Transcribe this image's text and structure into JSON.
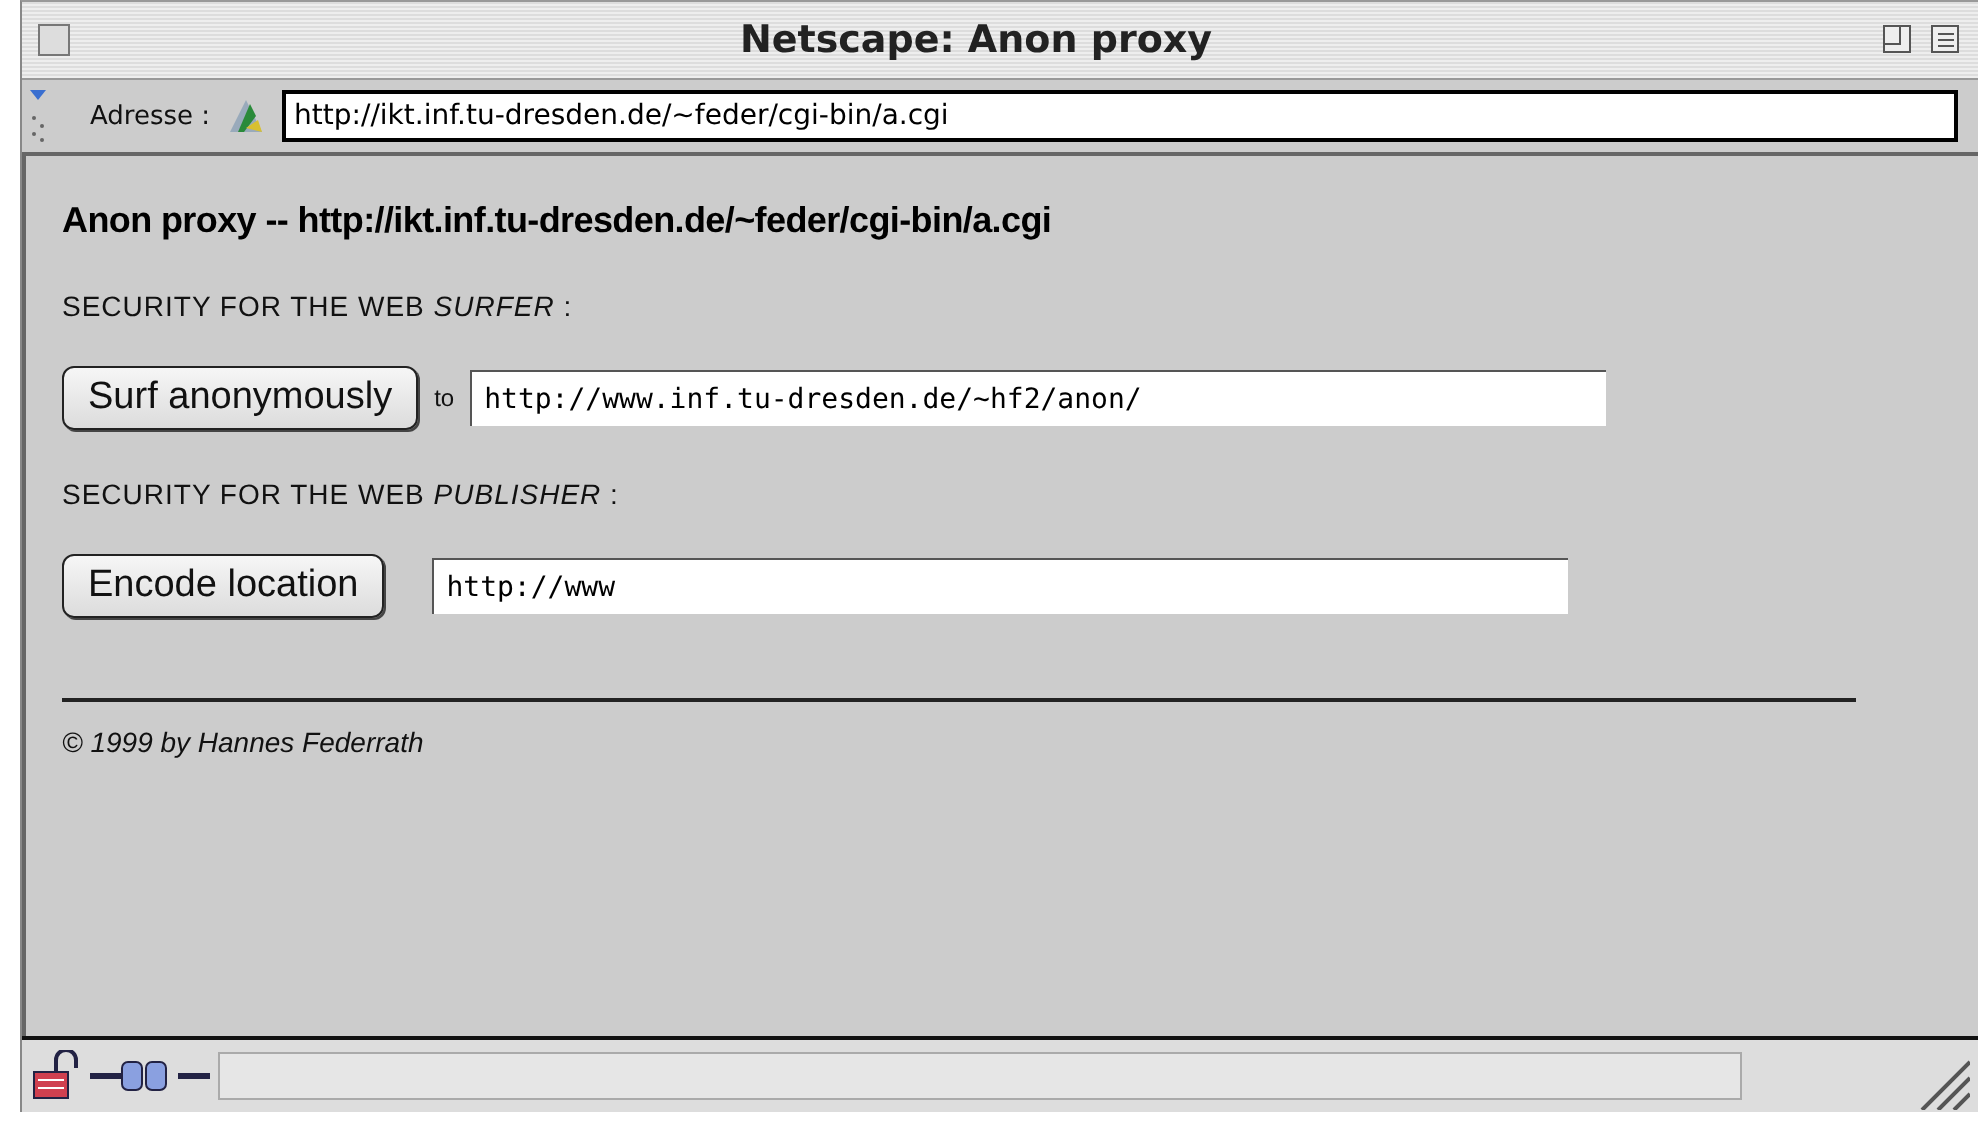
{
  "window": {
    "title": "Netscape: Anon proxy"
  },
  "address_bar": {
    "label": "Adresse :",
    "value": "http://ikt.inf.tu-dresden.de/~feder/cgi-bin/a.cgi"
  },
  "page": {
    "heading": "Anon proxy -- http://ikt.inf.tu-dresden.de/~feder/cgi-bin/a.cgi",
    "sections": [
      {
        "caption": "SECURITY FOR THE WEB *SURFER* :",
        "button": "Surf anonymously",
        "connector": "to",
        "field_value": "http://www.inf.tu-dresden.de/~hf2/anon/"
      },
      {
        "caption": "SECURITY FOR THE WEB *PUBLISHER* :",
        "button": "Encode location",
        "field_value": "http://www"
      }
    ],
    "footer": "© 1999 by Hannes Federrath"
  }
}
